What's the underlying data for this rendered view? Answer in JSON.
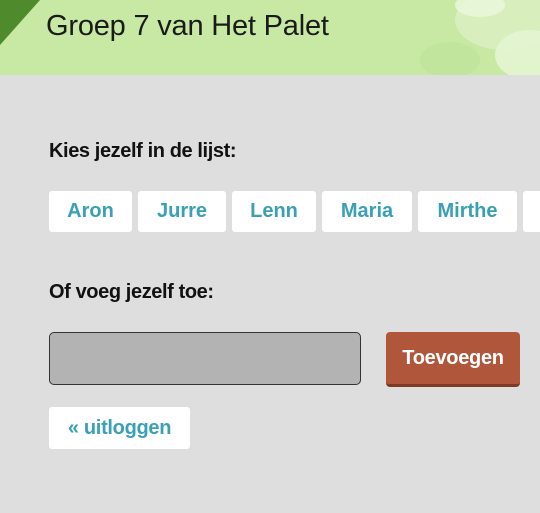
{
  "header": {
    "title": "Groep 7 van Het Palet"
  },
  "select": {
    "label": "Kies jezelf in de lijst:",
    "names": [
      "Aron",
      "Jurre",
      "Lenn",
      "Maria",
      "Mirthe",
      ""
    ]
  },
  "add": {
    "label": "Of voeg jezelf toe:",
    "input_value": "",
    "button_label": "Toevoegen"
  },
  "logout": {
    "label": "« uitloggen"
  }
}
